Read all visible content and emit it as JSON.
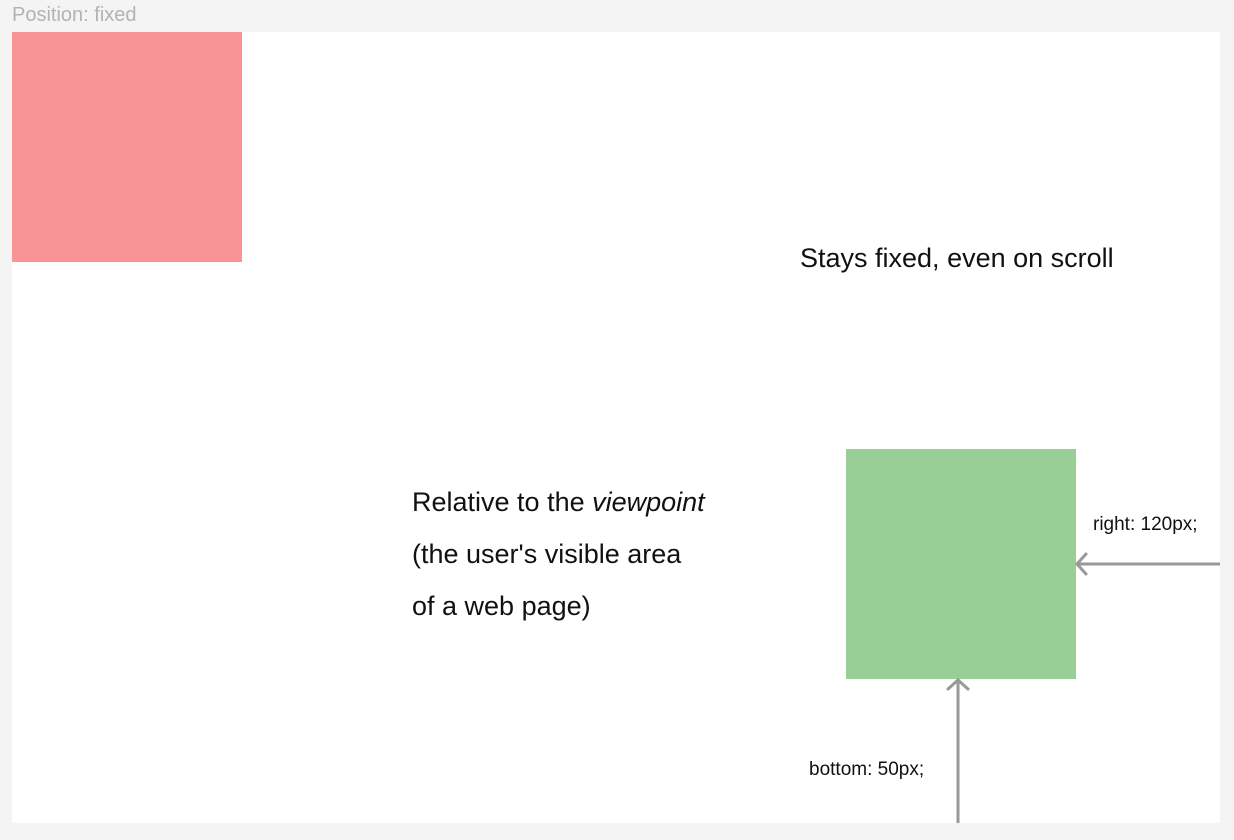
{
  "frame": {
    "title": "Position: fixed"
  },
  "boxes": {
    "red": {
      "color": "#f99494"
    },
    "green": {
      "color": "#99ce97"
    }
  },
  "captions": {
    "fixed": "Stays fixed, even on scroll",
    "relative_line1_prefix": "Relative to the ",
    "relative_line1_emphasis": "viewpoint",
    "relative_line2": "(the user's visible area",
    "relative_line3": "of a web page)"
  },
  "measurements": {
    "right": "right: 120px;",
    "bottom": "bottom: 50px;"
  },
  "colors": {
    "arrow": "#999999",
    "background": "#f4f4f4",
    "canvas": "#ffffff",
    "frame_label": "#b3b3b3"
  }
}
